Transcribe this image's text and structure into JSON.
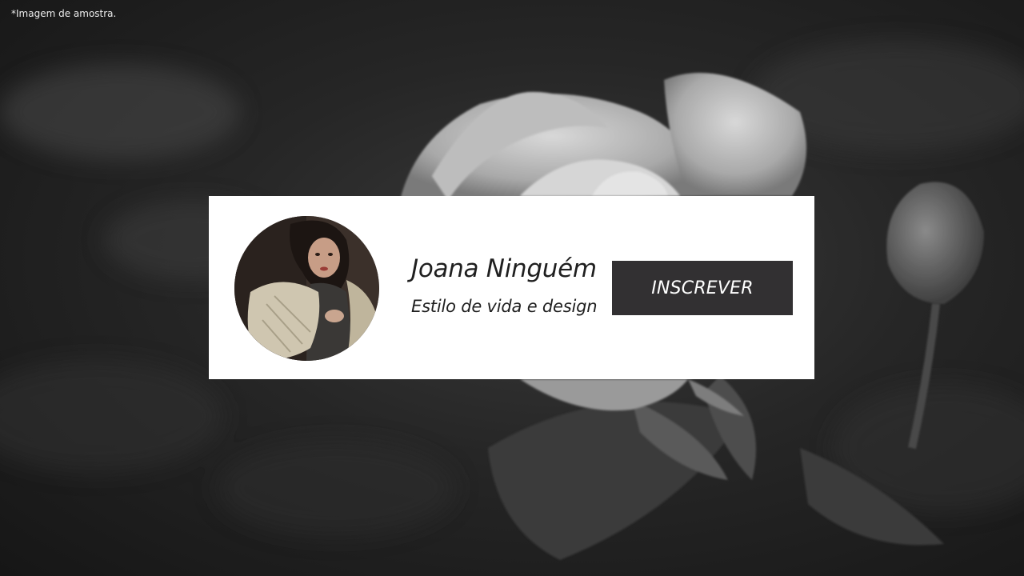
{
  "note": "*Imagem de amostra.",
  "profile": {
    "name": "Joana Ninguém",
    "tagline": "Estilo de vida e design"
  },
  "actions": {
    "subscribe_label": "INSCREVER"
  },
  "colors": {
    "card_background": "#ffffff",
    "button_background": "#323032",
    "button_text": "#ffffff",
    "text_dark": "#1f1f1f"
  },
  "icons": {
    "background": "rose-photo",
    "avatar": "profile-photo"
  }
}
